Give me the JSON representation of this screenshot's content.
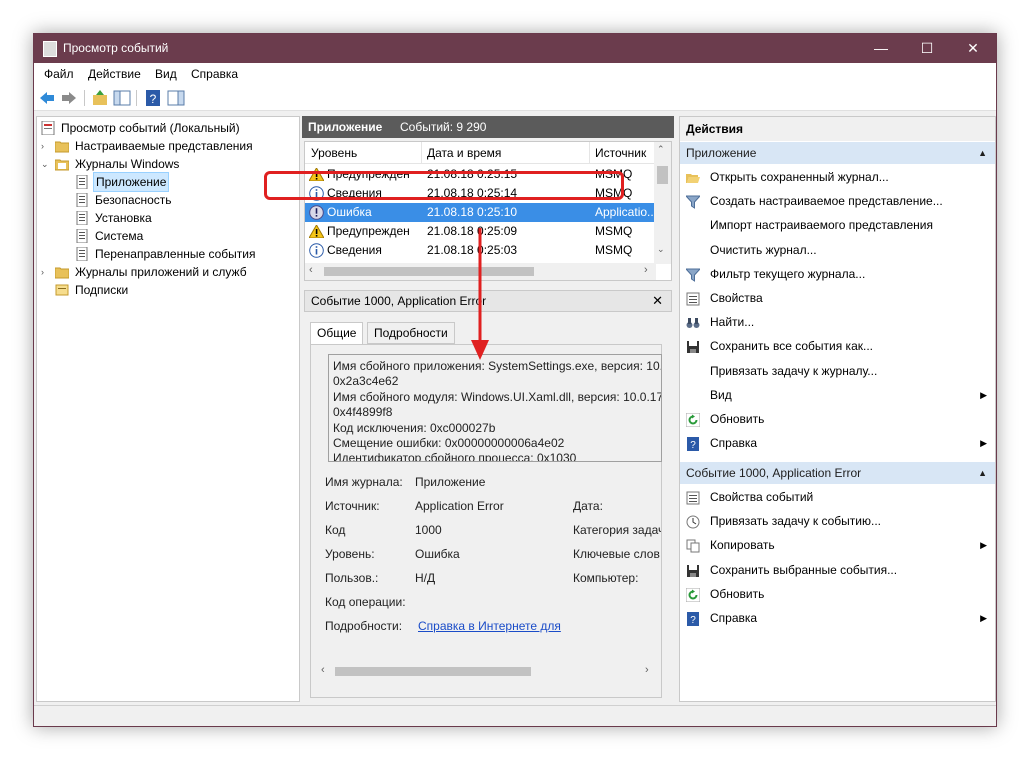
{
  "window": {
    "title": "Просмотр событий"
  },
  "menu": [
    "Файл",
    "Действие",
    "Вид",
    "Справка"
  ],
  "tree": [
    {
      "label": "Просмотр событий (Локальный)",
      "icon": "event-viewer-icon"
    },
    {
      "label": "Настраиваемые представления",
      "icon": "folder-icon"
    },
    {
      "label": "Журналы Windows",
      "icon": "folder-open-icon"
    },
    {
      "label": "Приложение",
      "icon": "log-icon"
    },
    {
      "label": "Безопасность",
      "icon": "log-icon"
    },
    {
      "label": "Установка",
      "icon": "log-icon"
    },
    {
      "label": "Система",
      "icon": "log-icon"
    },
    {
      "label": "Перенаправленные события",
      "icon": "log-icon"
    },
    {
      "label": "Журналы приложений и служб",
      "icon": "folder-icon"
    },
    {
      "label": "Подписки",
      "icon": "subscription-icon"
    }
  ],
  "center": {
    "header_title": "Приложение",
    "header_count": "Событий: 9 290",
    "columns": [
      "Уровень",
      "Дата и время",
      "Источник"
    ],
    "rows": [
      {
        "level": "Предупрежден",
        "date": "21.08.18 0:25:15",
        "source": "MSMQ",
        "icon": "warning-icon"
      },
      {
        "level": "Сведения",
        "date": "21.08.18 0:25:14",
        "source": "MSMQ",
        "icon": "info-icon"
      },
      {
        "level": "Ошибка",
        "date": "21.08.18 0:25:10",
        "source": "Applicatio...",
        "icon": "error-icon"
      },
      {
        "level": "Предупрежден",
        "date": "21.08.18 0:25:09",
        "source": "MSMQ",
        "icon": "warning-icon"
      },
      {
        "level": "Сведения",
        "date": "21.08.18 0:25:03",
        "source": "MSMQ",
        "icon": "info-icon"
      }
    ]
  },
  "detail": {
    "title": "Событие 1000, Application Error",
    "tabs": [
      "Общие",
      "Подробности"
    ],
    "text_lines": [
      "Имя сбойного приложения: SystemSettings.exe, версия: 10.0",
      "0x2a3c4e62",
      "Имя сбойного модуля: Windows.UI.Xaml.dll, версия: 10.0.171",
      "0x4f4899f8",
      "Код исключения: 0xc000027b",
      "Смещение ошибки: 0x00000000006a4e02",
      "Идентификатор сбойного процесса: 0x1030"
    ],
    "props": {
      "log_name_label": "Имя журнала:",
      "log_name_value": "Приложение",
      "source_label": "Источник:",
      "source_value": "Application Error",
      "date_label": "Дата:",
      "code_label": "Код",
      "code_value": "1000",
      "category_label": "Категория задач",
      "level_label": "Уровень:",
      "level_value": "Ошибка",
      "keywords_label": "Ключевые слов",
      "user_label": "Пользов.:",
      "user_value": "Н/Д",
      "computer_label": "Компьютер:",
      "opcode_label": "Код операции:",
      "more_label": "Подробности:",
      "more_link": "Справка в Интернете для"
    }
  },
  "actions": {
    "header": "Действия",
    "section1": "Приложение",
    "items1": [
      {
        "label": "Открыть сохраненный журнал...",
        "icon": "open-folder-icon"
      },
      {
        "label": "Создать настраиваемое представление...",
        "icon": "filter-icon"
      },
      {
        "label": "Импорт настраиваемого представления",
        "icon": ""
      },
      {
        "label": "Очистить журнал...",
        "icon": ""
      },
      {
        "label": "Фильтр текущего журнала...",
        "icon": "filter-icon"
      },
      {
        "label": "Свойства",
        "icon": "properties-icon"
      },
      {
        "label": "Найти...",
        "icon": "binoculars-icon"
      },
      {
        "label": "Сохранить все события как...",
        "icon": "save-icon"
      },
      {
        "label": "Привязать задачу к журналу...",
        "icon": ""
      },
      {
        "label": "Вид",
        "icon": "",
        "arrow": "▶"
      },
      {
        "label": "Обновить",
        "icon": "refresh-icon"
      },
      {
        "label": "Справка",
        "icon": "help-icon",
        "arrow": "▶"
      }
    ],
    "section2": "Событие 1000, Application Error",
    "items2": [
      {
        "label": "Свойства событий",
        "icon": "properties-icon"
      },
      {
        "label": "Привязать задачу к событию...",
        "icon": "task-icon"
      },
      {
        "label": "Копировать",
        "icon": "copy-icon",
        "arrow": "▶"
      },
      {
        "label": "Сохранить выбранные события...",
        "icon": "save-icon"
      },
      {
        "label": "Обновить",
        "icon": "refresh-icon"
      },
      {
        "label": "Справка",
        "icon": "help-icon",
        "arrow": "▶"
      }
    ]
  },
  "colors": {
    "titlebar": "#6b3c4d",
    "selection": "#3a8ee6",
    "annotation": "#e02020"
  }
}
